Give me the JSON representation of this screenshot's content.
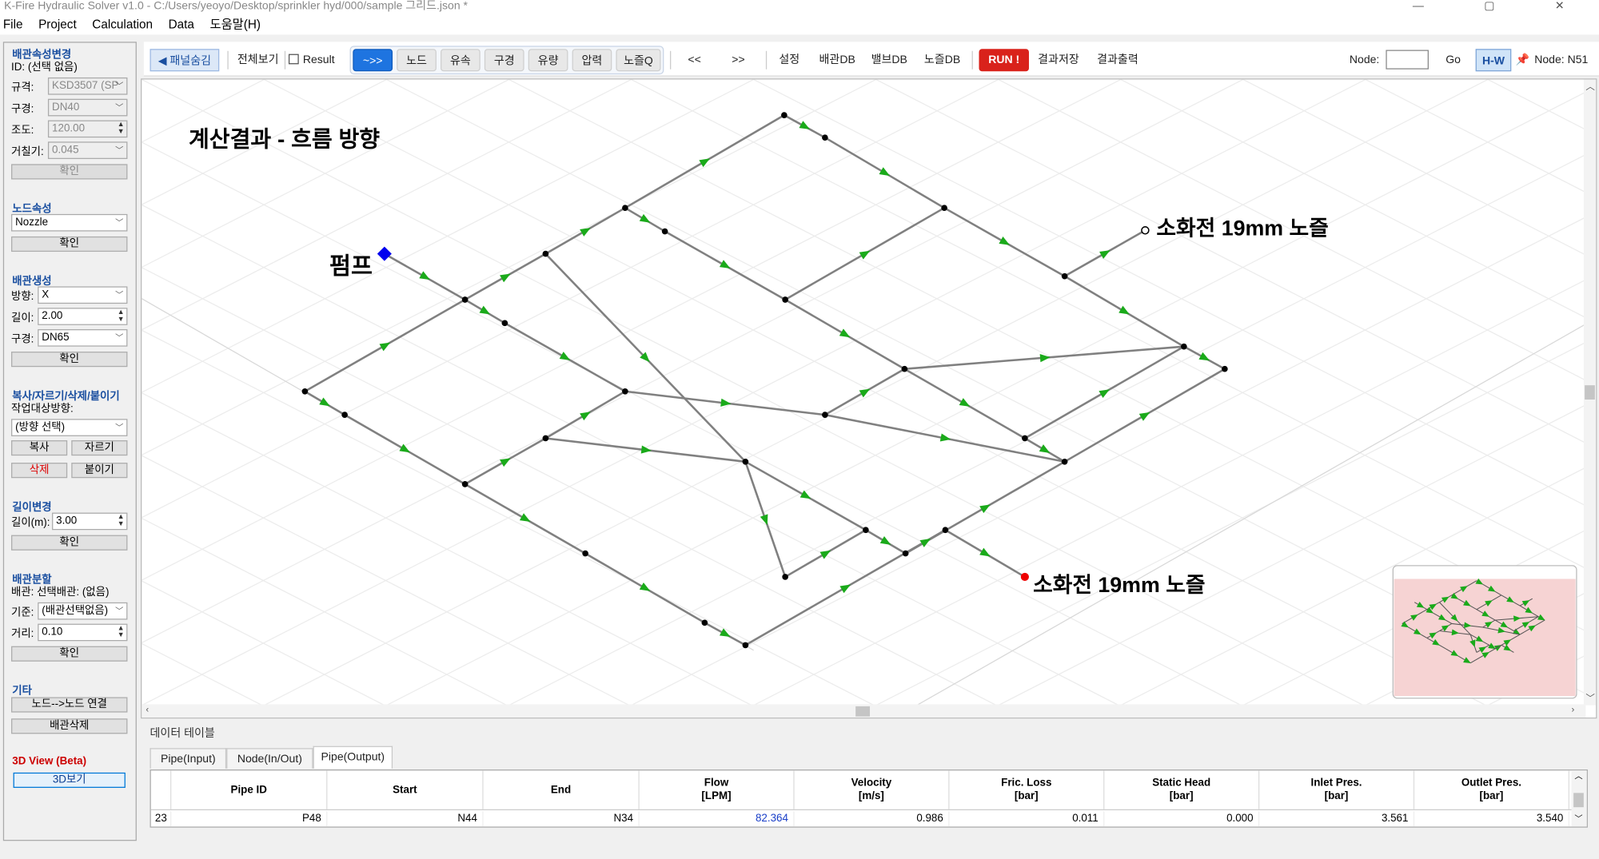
{
  "window": {
    "title": "K-Fire Hydraulic Solver v1.0 - C:/Users/yeoyo/Desktop/sprinkler hyd/000/sample 그리드.json *",
    "controls": "—  ▢  ✕"
  },
  "menu": [
    "File",
    "Project",
    "Calculation",
    "Data",
    "도움말(H)"
  ],
  "left_panel": {
    "pipe_props": {
      "title": "배관속성변경",
      "id_text": "ID: (선택 없음)",
      "spec_label": "규격:",
      "spec_value": "KSD3507 (SP",
      "dia_label": "구경:",
      "dia_value": "DN40",
      "c_label": "조도:",
      "c_value": "120.00",
      "rough_label": "거칠기:",
      "rough_value": "0.045",
      "confirm": "확인"
    },
    "node_props": {
      "title": "노드속성",
      "type_value": "Nozzle",
      "confirm": "확인"
    },
    "pipe_create": {
      "title": "배관생성",
      "dir_label": "방향:",
      "dir_value": "X",
      "len_label": "길이:",
      "len_value": "2.00",
      "dia_label": "구경:",
      "dia_value": "DN65",
      "confirm": "확인"
    },
    "copy_cut": {
      "title": "복사/자르기/삭제/붙이기",
      "target_label": "작업대상방향:",
      "target_value": "(방향 선택)",
      "copy": "복사",
      "cut": "자르기",
      "delete": "삭제",
      "paste": "붙이기"
    },
    "length_change": {
      "title": "길이변경",
      "len_label": "길이(m):",
      "len_value": "3.00",
      "confirm": "확인"
    },
    "pipe_split": {
      "title": "배관분할",
      "pipe_text": "배관: 선택배관: (없음)",
      "base_label": "기준:",
      "base_value": "(배관선택없음)",
      "dist_label": "거리:",
      "dist_value": "0.10",
      "confirm": "확인"
    },
    "etc": {
      "title": "기타",
      "connect": "노드-->노드 연결",
      "delete_pipe": "배관삭제"
    },
    "view3d": {
      "title": "3D View (Beta)",
      "button": "3D보기"
    }
  },
  "toolbar": {
    "panel_hide": "◀ 패널숨김",
    "view_all": "전체보기",
    "result_label": "Result",
    "modes": [
      "~>>",
      "노드",
      "유속",
      "구경",
      "유량",
      "압력",
      "노즐Q"
    ],
    "prev": "<<",
    "next": ">>",
    "settings": "설정",
    "pipe_db": "배관DB",
    "valve_db": "밸브DB",
    "nozzle_db": "노즐DB",
    "run": "RUN !",
    "save_result": "결과저장",
    "print_result": "결과출력",
    "node_label": "Node:",
    "node_input": "",
    "go": "Go",
    "hw": "H-W",
    "pinned_node": "Node: N51"
  },
  "canvas": {
    "title": "계산결과 - 흐름 방향",
    "pump_label": "펌프",
    "nozzle_label_1": "소화전 19mm 노즐",
    "nozzle_label_2": "소화전 19mm 노즐",
    "colors": {
      "pipe": "#808080",
      "node": "#000000",
      "arrow": "#1aaa1a",
      "pump": "#0000ee",
      "active_nozzle": "#ee0000",
      "minimap_bg": "#f6d3d3"
    }
  },
  "data_table": {
    "title": "데이터 테이블",
    "tabs": [
      "Pipe(Input)",
      "Node(In/Out)",
      "Pipe(Output)"
    ],
    "columns": [
      "Pipe ID",
      "Start",
      "End",
      "Flow\n[LPM]",
      "Velocity\n[m/s]",
      "Fric. Loss\n[bar]",
      "Static Head\n[bar]",
      "Inlet Pres.\n[bar]",
      "Outlet Pres.\n[bar]"
    ],
    "row": {
      "index": "23",
      "pipe_id": "P48",
      "start": "N44",
      "end": "N34",
      "flow": "82.364",
      "velocity": "0.986",
      "fric_loss": "0.011",
      "static_head": "0.000",
      "inlet": "3.561",
      "outlet": "3.540"
    }
  }
}
